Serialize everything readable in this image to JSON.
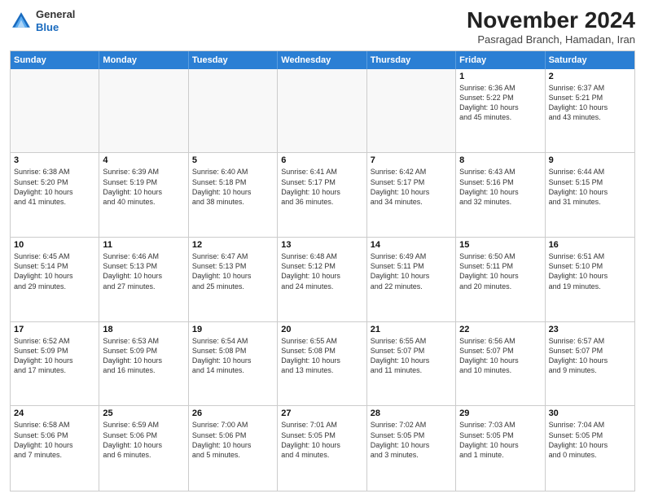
{
  "logo": {
    "line1": "General",
    "line2": "Blue"
  },
  "header": {
    "month": "November 2024",
    "location": "Pasragad Branch, Hamadan, Iran"
  },
  "weekdays": [
    "Sunday",
    "Monday",
    "Tuesday",
    "Wednesday",
    "Thursday",
    "Friday",
    "Saturday"
  ],
  "rows": [
    [
      {
        "day": "",
        "info": ""
      },
      {
        "day": "",
        "info": ""
      },
      {
        "day": "",
        "info": ""
      },
      {
        "day": "",
        "info": ""
      },
      {
        "day": "",
        "info": ""
      },
      {
        "day": "1",
        "info": "Sunrise: 6:36 AM\nSunset: 5:22 PM\nDaylight: 10 hours\nand 45 minutes."
      },
      {
        "day": "2",
        "info": "Sunrise: 6:37 AM\nSunset: 5:21 PM\nDaylight: 10 hours\nand 43 minutes."
      }
    ],
    [
      {
        "day": "3",
        "info": "Sunrise: 6:38 AM\nSunset: 5:20 PM\nDaylight: 10 hours\nand 41 minutes."
      },
      {
        "day": "4",
        "info": "Sunrise: 6:39 AM\nSunset: 5:19 PM\nDaylight: 10 hours\nand 40 minutes."
      },
      {
        "day": "5",
        "info": "Sunrise: 6:40 AM\nSunset: 5:18 PM\nDaylight: 10 hours\nand 38 minutes."
      },
      {
        "day": "6",
        "info": "Sunrise: 6:41 AM\nSunset: 5:17 PM\nDaylight: 10 hours\nand 36 minutes."
      },
      {
        "day": "7",
        "info": "Sunrise: 6:42 AM\nSunset: 5:17 PM\nDaylight: 10 hours\nand 34 minutes."
      },
      {
        "day": "8",
        "info": "Sunrise: 6:43 AM\nSunset: 5:16 PM\nDaylight: 10 hours\nand 32 minutes."
      },
      {
        "day": "9",
        "info": "Sunrise: 6:44 AM\nSunset: 5:15 PM\nDaylight: 10 hours\nand 31 minutes."
      }
    ],
    [
      {
        "day": "10",
        "info": "Sunrise: 6:45 AM\nSunset: 5:14 PM\nDaylight: 10 hours\nand 29 minutes."
      },
      {
        "day": "11",
        "info": "Sunrise: 6:46 AM\nSunset: 5:13 PM\nDaylight: 10 hours\nand 27 minutes."
      },
      {
        "day": "12",
        "info": "Sunrise: 6:47 AM\nSunset: 5:13 PM\nDaylight: 10 hours\nand 25 minutes."
      },
      {
        "day": "13",
        "info": "Sunrise: 6:48 AM\nSunset: 5:12 PM\nDaylight: 10 hours\nand 24 minutes."
      },
      {
        "day": "14",
        "info": "Sunrise: 6:49 AM\nSunset: 5:11 PM\nDaylight: 10 hours\nand 22 minutes."
      },
      {
        "day": "15",
        "info": "Sunrise: 6:50 AM\nSunset: 5:11 PM\nDaylight: 10 hours\nand 20 minutes."
      },
      {
        "day": "16",
        "info": "Sunrise: 6:51 AM\nSunset: 5:10 PM\nDaylight: 10 hours\nand 19 minutes."
      }
    ],
    [
      {
        "day": "17",
        "info": "Sunrise: 6:52 AM\nSunset: 5:09 PM\nDaylight: 10 hours\nand 17 minutes."
      },
      {
        "day": "18",
        "info": "Sunrise: 6:53 AM\nSunset: 5:09 PM\nDaylight: 10 hours\nand 16 minutes."
      },
      {
        "day": "19",
        "info": "Sunrise: 6:54 AM\nSunset: 5:08 PM\nDaylight: 10 hours\nand 14 minutes."
      },
      {
        "day": "20",
        "info": "Sunrise: 6:55 AM\nSunset: 5:08 PM\nDaylight: 10 hours\nand 13 minutes."
      },
      {
        "day": "21",
        "info": "Sunrise: 6:55 AM\nSunset: 5:07 PM\nDaylight: 10 hours\nand 11 minutes."
      },
      {
        "day": "22",
        "info": "Sunrise: 6:56 AM\nSunset: 5:07 PM\nDaylight: 10 hours\nand 10 minutes."
      },
      {
        "day": "23",
        "info": "Sunrise: 6:57 AM\nSunset: 5:07 PM\nDaylight: 10 hours\nand 9 minutes."
      }
    ],
    [
      {
        "day": "24",
        "info": "Sunrise: 6:58 AM\nSunset: 5:06 PM\nDaylight: 10 hours\nand 7 minutes."
      },
      {
        "day": "25",
        "info": "Sunrise: 6:59 AM\nSunset: 5:06 PM\nDaylight: 10 hours\nand 6 minutes."
      },
      {
        "day": "26",
        "info": "Sunrise: 7:00 AM\nSunset: 5:06 PM\nDaylight: 10 hours\nand 5 minutes."
      },
      {
        "day": "27",
        "info": "Sunrise: 7:01 AM\nSunset: 5:05 PM\nDaylight: 10 hours\nand 4 minutes."
      },
      {
        "day": "28",
        "info": "Sunrise: 7:02 AM\nSunset: 5:05 PM\nDaylight: 10 hours\nand 3 minutes."
      },
      {
        "day": "29",
        "info": "Sunrise: 7:03 AM\nSunset: 5:05 PM\nDaylight: 10 hours\nand 1 minute."
      },
      {
        "day": "30",
        "info": "Sunrise: 7:04 AM\nSunset: 5:05 PM\nDaylight: 10 hours\nand 0 minutes."
      }
    ]
  ]
}
